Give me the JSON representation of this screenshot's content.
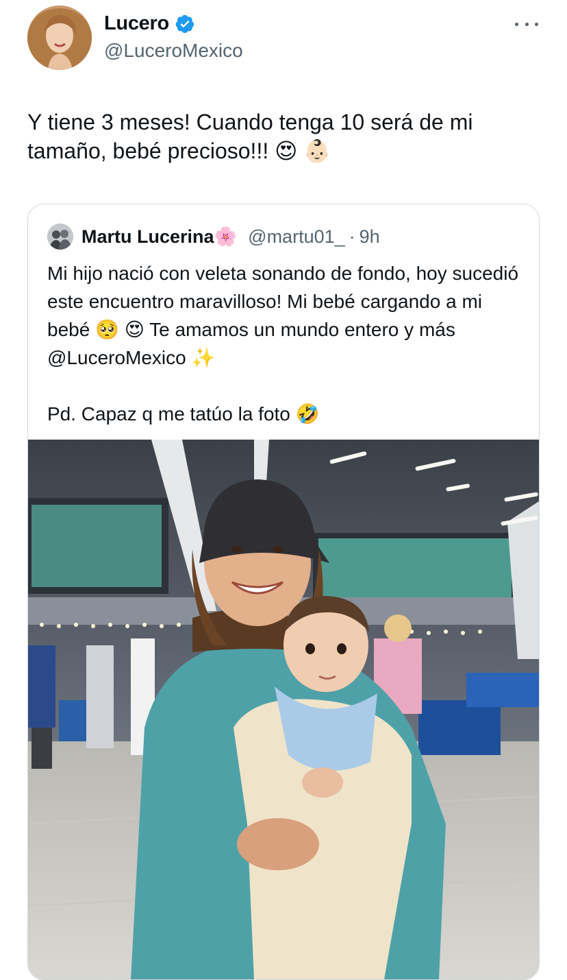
{
  "tweet": {
    "author": {
      "name": "Lucero",
      "handle": "@LuceroMexico",
      "verified": true,
      "avatar_icon": "profile-photo"
    },
    "more_icon": "more-horizontal-icon",
    "text": "Y tiene 3 meses! Cuando tenga 10 será de mi tamaño, bebé precioso!!! 😍 👶🏻"
  },
  "quote": {
    "author": {
      "name": "Martu Lucerina🌸",
      "handle": "@martu01_",
      "separator": "·",
      "time": "9h"
    },
    "text": "Mi hijo nació con veleta sonando de fondo, hoy sucedió este encuentro maravilloso! Mi bebé cargando a mi bebé 🥺 😍 Te amamos un mundo entero y más @LuceroMexico ✨\n\nPd. Capaz q me tatúo la foto 🤣",
    "photo_icon": "airport-photo"
  },
  "colors": {
    "text": "#0f1419",
    "secondary": "#536471",
    "border": "#cfd9de",
    "verified": "#1d9bf0"
  }
}
